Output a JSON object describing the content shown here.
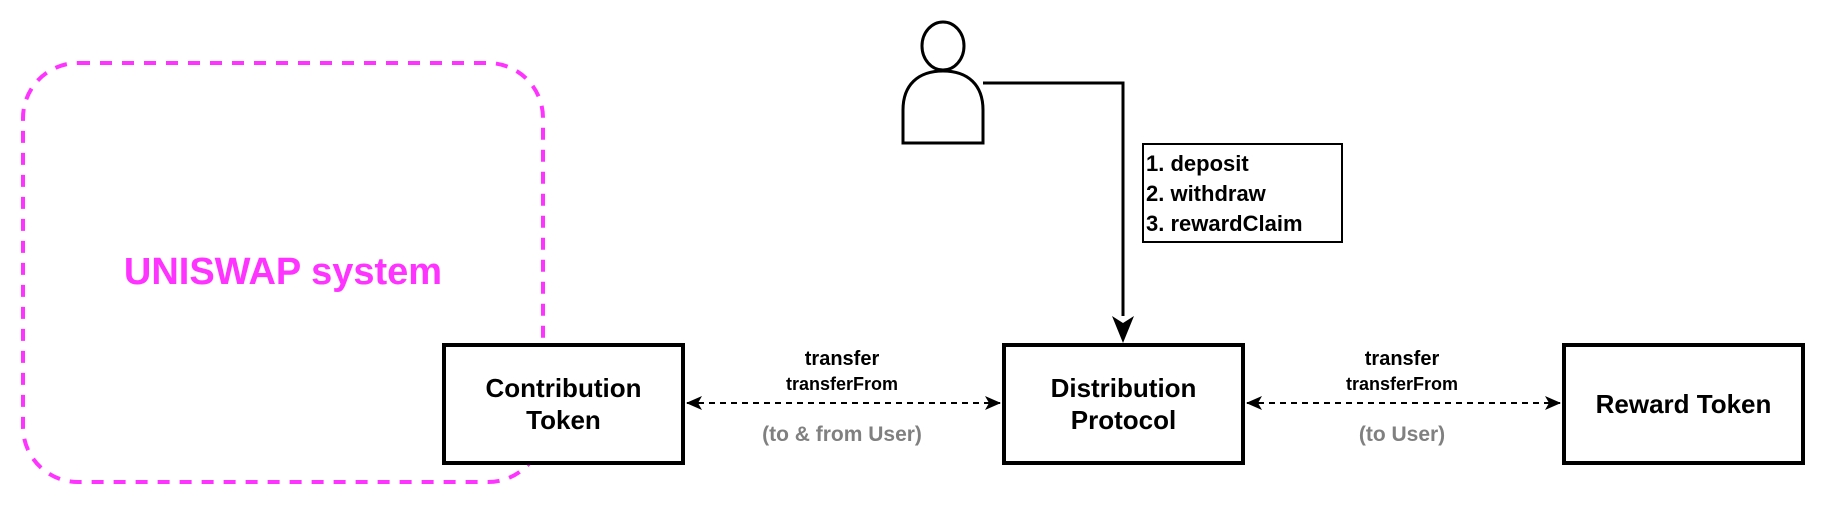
{
  "diagram": {
    "group": {
      "label": "UNISWAP system",
      "color": "#FF33FF",
      "style": "dashed-rounded"
    },
    "actor": {
      "name": "user",
      "icon": "user-icon"
    },
    "actions": {
      "items": [
        "1. deposit",
        "2. withdraw",
        "3. rewardClaim"
      ]
    },
    "nodes": {
      "contribution": {
        "line1": "Contribution",
        "line2": "Token"
      },
      "distribution": {
        "line1": "Distribution",
        "line2": "Protocol"
      },
      "reward": {
        "line1": "Reward Token"
      }
    },
    "edges": {
      "left": {
        "from": "Distribution Protocol",
        "to": "Contribution Token",
        "direction": "bidirectional",
        "style": "dashed",
        "label1": "transfer",
        "label2": "transferFrom",
        "sublabel": "(to & from User)",
        "sublabel_color": "#808080"
      },
      "right": {
        "from": "Distribution Protocol",
        "to": "Reward Token",
        "direction": "bidirectional",
        "style": "dashed",
        "label1": "transfer",
        "label2": "transferFrom",
        "sublabel": "(to User)",
        "sublabel_color": "#808080"
      },
      "actor_to_distribution": {
        "from": "user",
        "to": "Distribution Protocol",
        "style": "solid"
      }
    }
  }
}
